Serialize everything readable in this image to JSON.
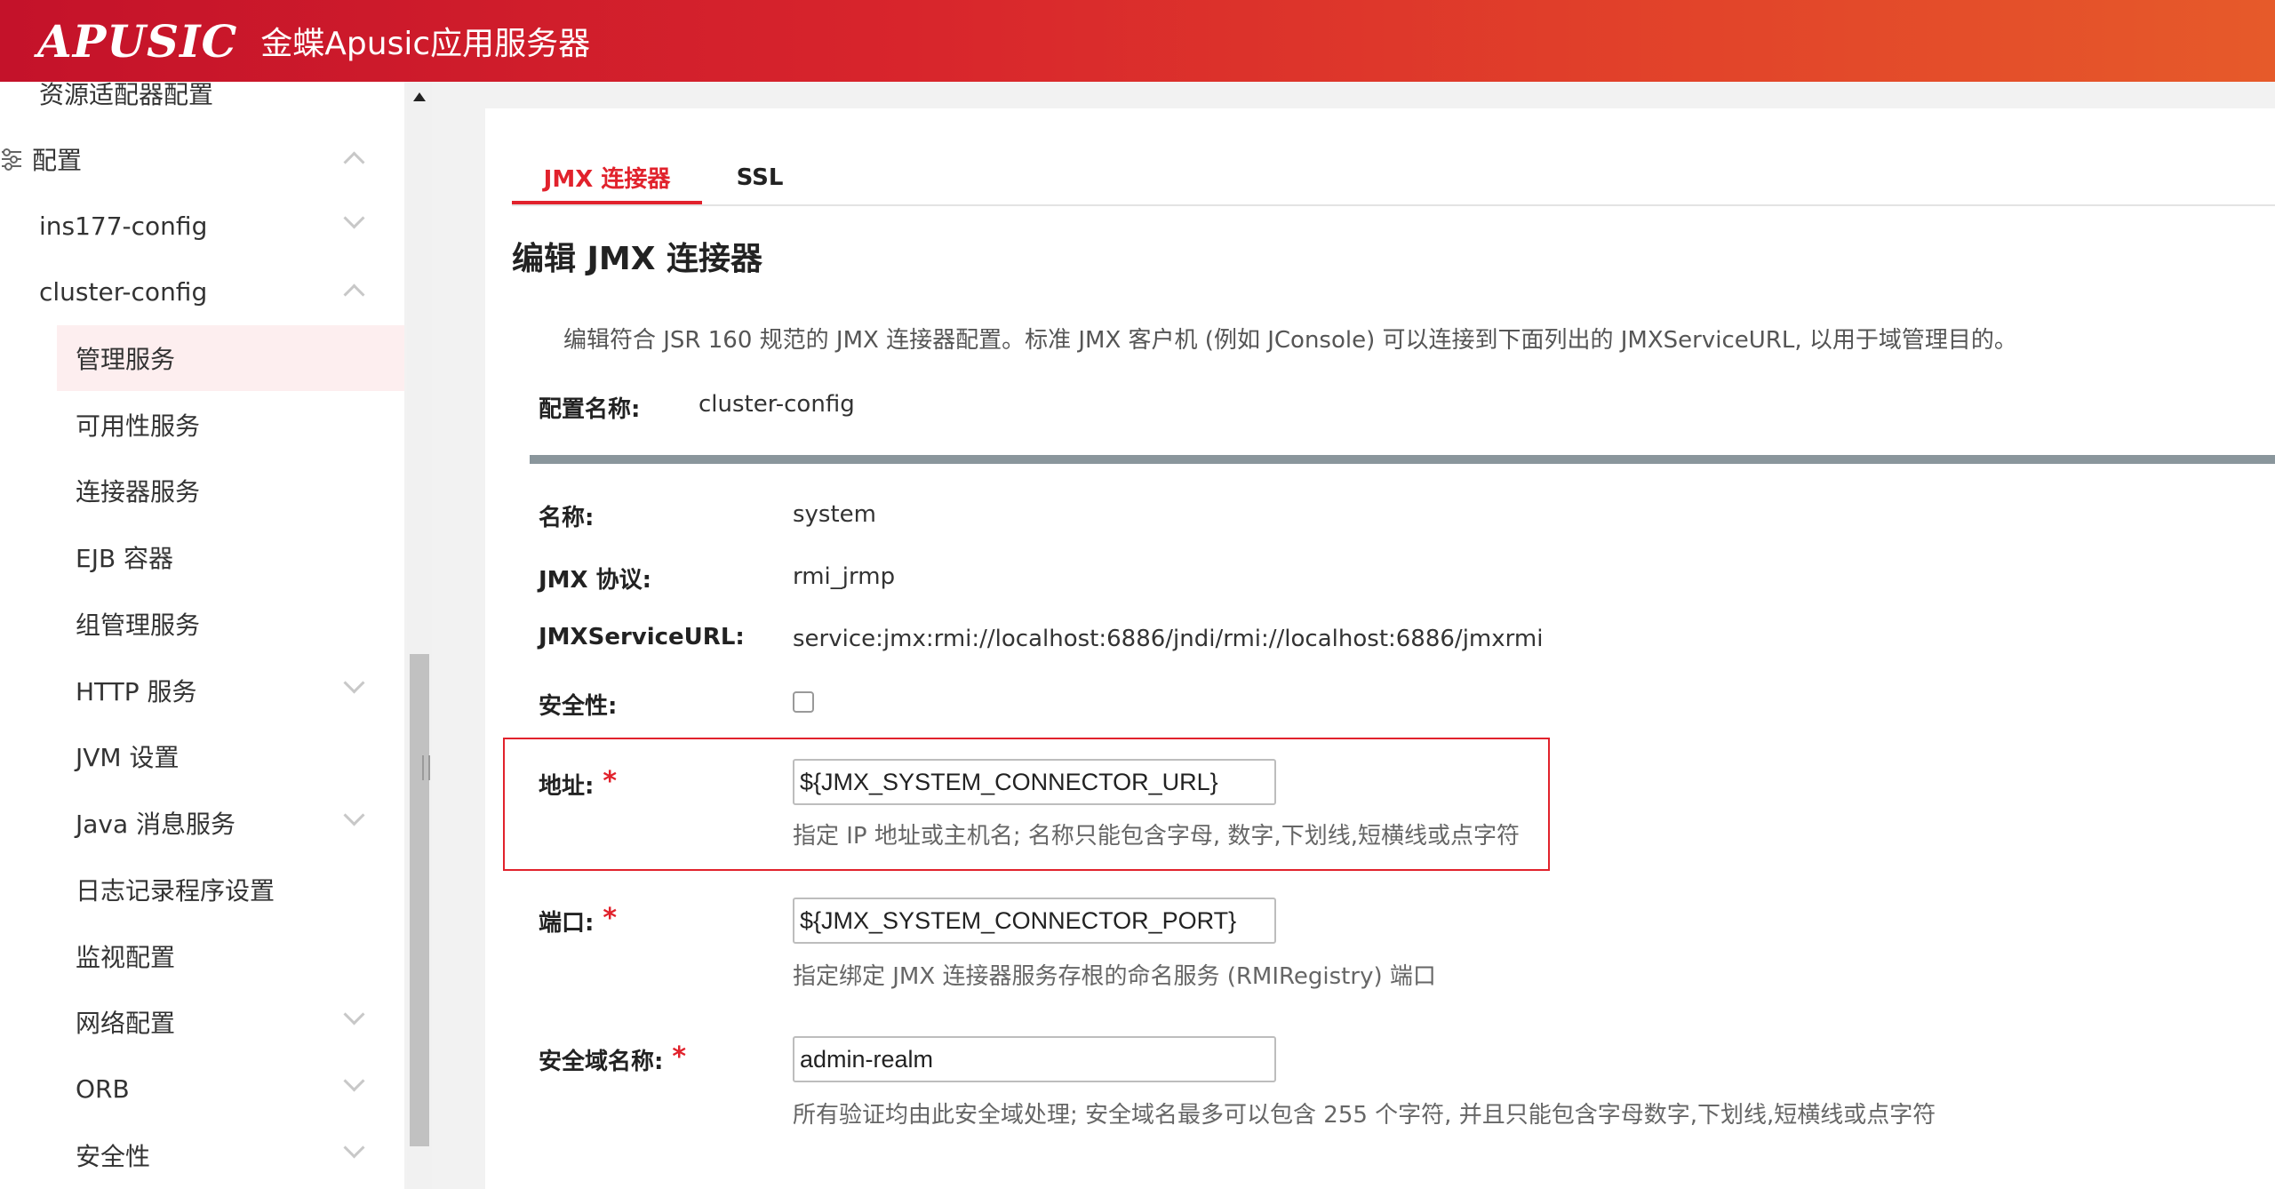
{
  "header": {
    "logo": "APUSIC",
    "title": "金蝶Apusic应用服务器"
  },
  "sidebar": {
    "items": [
      {
        "label": "资源适配器配置"
      },
      {
        "label": "配置"
      },
      {
        "label": "ins177-config"
      },
      {
        "label": "cluster-config"
      },
      {
        "label": "管理服务"
      },
      {
        "label": "可用性服务"
      },
      {
        "label": "连接器服务"
      },
      {
        "label": "EJB 容器"
      },
      {
        "label": "组管理服务"
      },
      {
        "label": "HTTP 服务"
      },
      {
        "label": "JVM 设置"
      },
      {
        "label": "Java 消息服务"
      },
      {
        "label": "日志记录程序设置"
      },
      {
        "label": "监视配置"
      },
      {
        "label": "网络配置"
      },
      {
        "label": "ORB"
      },
      {
        "label": "安全性"
      }
    ]
  },
  "tabs": [
    {
      "label": "JMX 连接器"
    },
    {
      "label": "SSL"
    }
  ],
  "page": {
    "title": "编辑 JMX 连接器",
    "description": "编辑符合 JSR 160 规范的 JMX 连接器配置。标准 JMX 客户机 (例如 JConsole) 可以连接到下面列出的 JMXServiceURL, 以用于域管理目的。",
    "config_name_label": "配置名称:",
    "config_name_value": "cluster-config"
  },
  "fields": {
    "name_label": "名称:",
    "name_value": "system",
    "protocol_label": "JMX 协议:",
    "protocol_value": "rmi_jrmp",
    "url_label": "JMXServiceURL:",
    "url_value": "service:jmx:rmi://localhost:6886/jndi/rmi://localhost:6886/jmxrmi",
    "security_label": "安全性:",
    "address_label": "地址:",
    "address_value": "${JMX_SYSTEM_CONNECTOR_URL}",
    "address_hint": "指定 IP 地址或主机名; 名称只能包含字母, 数字,下划线,短横线或点字符",
    "port_label": "端口:",
    "port_value": "${JMX_SYSTEM_CONNECTOR_PORT}",
    "port_hint": "指定绑定 JMX 连接器服务存根的命名服务 (RMIRegistry) 端口",
    "realm_label": "安全域名称:",
    "realm_value": "admin-realm",
    "realm_hint": "所有验证均由此安全域处理; 安全域名最多可以包含 255 个字符, 并且只能包含字母数字,下划线,短横线或点字符",
    "required_mark": "*"
  },
  "colors": {
    "brand": "#d8252c",
    "accent": "#e1222c",
    "active_bg": "#fdeeef"
  }
}
